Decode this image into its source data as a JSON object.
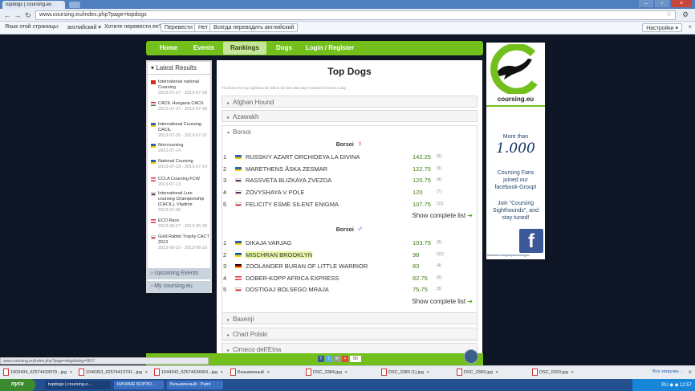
{
  "browser": {
    "tab_title": "topdogs | coursing.eu",
    "url": "www.coursing.eu/index.php?page=topdogs"
  },
  "translate_bar": {
    "prompt": "Язык этой страницы:",
    "language": "английский ▾",
    "question": "Хотите перевести ее?",
    "translate": "Перевести",
    "no": "Нет",
    "always": "Всегда переводить английский",
    "settings": "Настройки ▾"
  },
  "nav": {
    "items": [
      "Home",
      "Events",
      "Rankings",
      "Dogs",
      "Login / Register"
    ],
    "active": "Rankings"
  },
  "sidebar": {
    "title": "Latest Results",
    "results": [
      {
        "name": "International national Coursing",
        "date": "2013-07-27 - 2013-07-28",
        "flag": "switzerland"
      },
      {
        "name": "CACIL Hungaria CACIL",
        "date": "2013-07-27 - 2013-07-28",
        "flag": "hungary"
      },
      {
        "name": "International Coursing CACIL",
        "date": "2013-07-20 - 2013-07-21",
        "flag": "sweden"
      },
      {
        "name": "Norrcoursing",
        "date": "2013-07-14",
        "flag": "sweden"
      },
      {
        "name": "National Coursing",
        "date": "2013-07-13 - 2013-07-14",
        "flag": "sweden"
      },
      {
        "name": "CCLA Coursing FCW",
        "date": "2013-07-13",
        "flag": "austria"
      },
      {
        "name": "International Lure coursing Championship (CACIL), Vladimir",
        "date": "2013-07-06",
        "flag": "russia"
      },
      {
        "name": "ECO Race",
        "date": "2013-06-27 - 2013-06-30",
        "flag": "austria"
      },
      {
        "name": "Gold Rabbit Trophy CACT 2013",
        "date": "2013-06-22 - 2013-06-23",
        "flag": "czech"
      }
    ],
    "upcoming": "Upcoming Events",
    "my": "My coursing.eu"
  },
  "main": {
    "title": "Top Dogs",
    "subtitle": "Find here the top sighthounds within the last 365 days! Updated 3 times a day.",
    "breeds_collapsed_top": [
      "Afghan Hound",
      "Azawakh"
    ],
    "open_breed": "Borsoi",
    "female_title": "Borsoi",
    "female_symbol": "♀",
    "male_title": "Borsoi",
    "male_symbol": "♂",
    "females": [
      {
        "rank": "1",
        "flag": "sweden",
        "name": "RUSSKIY AZART ORCHIDEYA LA DIVINA",
        "points": "142.25",
        "count": "(6)"
      },
      {
        "rank": "2",
        "flag": "sweden",
        "name": "MARETHENS ÅSKA ZESMAR",
        "points": "122.75",
        "count": "(6)"
      },
      {
        "rank": "3",
        "flag": "russia",
        "name": "RASSVETA BLIZKAYA ZVEZDA",
        "points": "120.75",
        "count": "(4)"
      },
      {
        "rank": "4",
        "flag": "russia",
        "name": "ZOVYSHAYA V POLE",
        "points": "120",
        "count": "(7)"
      },
      {
        "rank": "5",
        "flag": "czech",
        "name": "FELICITY ESME SILENT ENIGMA",
        "points": "107.75",
        "count": "(11)"
      }
    ],
    "males": [
      {
        "rank": "1",
        "flag": "sweden",
        "name": "DIKAJA VARJAG",
        "points": "103.75",
        "count": "(6)"
      },
      {
        "rank": "2",
        "flag": "ukraine",
        "name": "MISCHRAN BROOKLYN",
        "points": "98",
        "count": "(12)"
      },
      {
        "rank": "3",
        "flag": "germany",
        "name": "ZOOLANDER BURAN OF LITTLE WARRIOR",
        "points": "83",
        "count": "(4)"
      },
      {
        "rank": "4",
        "flag": "austria",
        "name": "DOBER-KOPP AFRICA EXPRESS",
        "points": "82.75",
        "count": "(5)"
      },
      {
        "rank": "5",
        "flag": "czech",
        "name": "DOSTIGAJ BOLSEGO MRAJA",
        "points": "75.75",
        "count": "(5)"
      }
    ],
    "show_complete": "Show complete list",
    "breeds_collapsed_bottom": [
      "Basenji",
      "Chart Polski",
      "Cirneco dell'Etna"
    ]
  },
  "banner": {
    "logo_text": "coursing.eu",
    "line1": "More than",
    "big_number": "1.000",
    "line2": "Coursing Fans joined our facebook-Group!",
    "line3": "Join \"Coursing Sighthounds\", and stay tuned!",
    "fb_letter": "f",
    "link": "facebook.com/groups/coursing.eu"
  },
  "status_url": "www.coursing.eu/index.php?page=dogs&dog=6817",
  "downloads": [
    {
      "file": "1003434_62574433079...jpg"
    },
    {
      "file": "1040363_62574413741...jpg"
    },
    {
      "file": "1044342_62574434064...jpg"
    },
    {
      "file": "Безымянный"
    },
    {
      "file": "DSC_3384.jpg"
    },
    {
      "file": "DSC_3383 (1).jpg"
    },
    {
      "file": "DSC_3383.jpg"
    },
    {
      "file": "DSC_0023.jpg"
    }
  ],
  "downloads_show_all": "Все загрузки...",
  "taskbar": {
    "start": "пуск",
    "tasks": [
      "topdogs | coursing.e...",
      "КИЧИНЕ БОРЗО...",
      "Безымянный - Paint"
    ],
    "clock": "RU ◆ ◆ 12:57"
  },
  "colors": {
    "nav_green": "#73c01d",
    "page_bg": "#0e1524",
    "points_green": "#3c7d12",
    "highlight": "#e5f7a4"
  }
}
